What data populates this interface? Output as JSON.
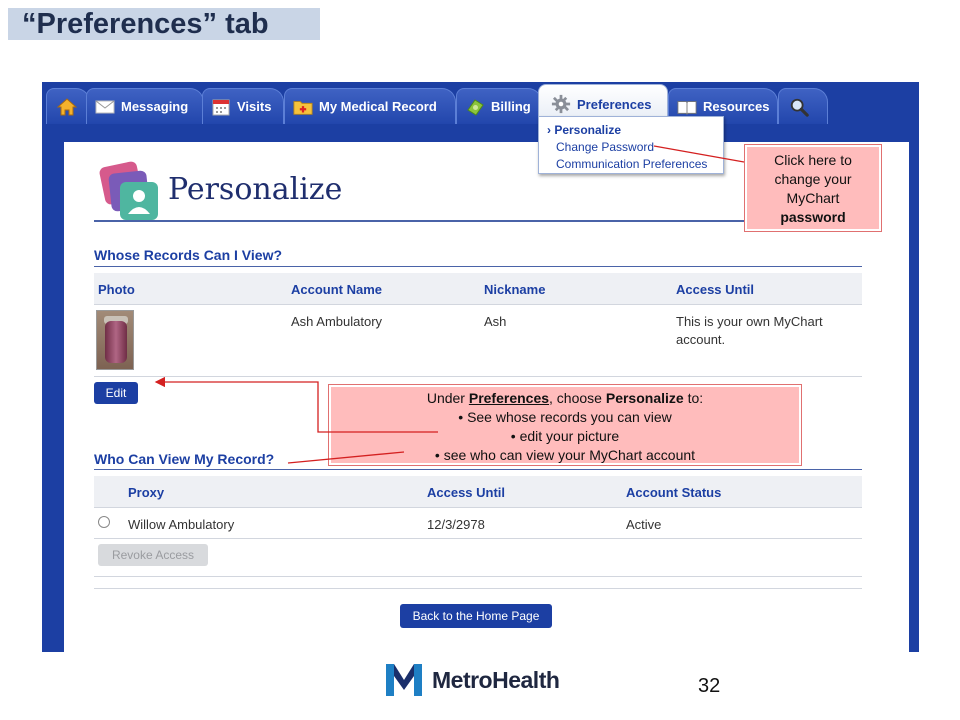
{
  "slide": {
    "title": "“Preferences” tab",
    "page_number": "32",
    "logo_text": "MetroHealth"
  },
  "tabs": {
    "messaging": "Messaging",
    "visits": "Visits",
    "medical_record": "My Medical Record",
    "billing": "Billing",
    "preferences": "Preferences",
    "resources": "Resources"
  },
  "dropdown": {
    "personalize": "› Personalize",
    "change_password": "Change Password",
    "communication": "Communication Preferences"
  },
  "page": {
    "title": "Personalize"
  },
  "whose_records": {
    "heading": "Whose Records Can I View?",
    "columns": [
      "Photo",
      "Account Name",
      "Nickname",
      "Access Until"
    ],
    "row": {
      "account_name": "Ash Ambulatory",
      "nickname": "Ash",
      "access_line1": "This is your own MyChart",
      "access_line2": "account."
    },
    "edit_label": "Edit"
  },
  "who_can_view": {
    "heading": "Who Can View My Record?",
    "columns": [
      "Proxy",
      "Access Until",
      "Account Status"
    ],
    "row": {
      "proxy": "Willow Ambulatory",
      "access_until": "12/3/2978",
      "status": "Active"
    },
    "revoke_label": "Revoke Access"
  },
  "back_home_label": "Back to the Home Page",
  "callouts": {
    "password": {
      "line1": "Click here to",
      "line2": "change your",
      "line3": "MyChart",
      "line4": "password"
    },
    "main": {
      "prefix": "Under ",
      "preferences": "Preferences",
      "mid": ", choose ",
      "personalize": "Personalize",
      "suffix": " to:",
      "bullets": [
        "See whose records you can view",
        "edit your picture",
        "see who can view your MyChart account"
      ]
    }
  },
  "colors": {
    "brand_blue": "#1c3fa3",
    "callout_fill": "#ffbcbc",
    "arrow_red": "#d42020"
  }
}
